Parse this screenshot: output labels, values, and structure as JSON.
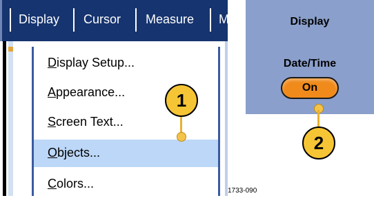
{
  "menubar": {
    "items": [
      {
        "label": "Display"
      },
      {
        "label": "Cursor"
      },
      {
        "label": "Measure"
      },
      {
        "label": "M"
      }
    ]
  },
  "dropdown": {
    "items": [
      {
        "label": "Display Setup...",
        "mnemonic": "D",
        "rest": "isplay Setup...",
        "selected": false
      },
      {
        "label": "Appearance...",
        "mnemonic": "A",
        "rest": "ppearance...",
        "selected": false
      },
      {
        "label": "Screen Text...",
        "mnemonic": "S",
        "rest": "creen Text...",
        "selected": false
      },
      {
        "label": "Objects...",
        "mnemonic": "O",
        "rest": "bjects...",
        "selected": true
      },
      {
        "label": "Colors...",
        "mnemonic": "C",
        "rest": "olors...",
        "selected": false
      }
    ]
  },
  "panel": {
    "title": "Display",
    "subtitle": "Date/Time",
    "toggle_label": "On"
  },
  "callouts": {
    "step1": "1",
    "step2": "2"
  },
  "figure_id": "1733-090",
  "colors": {
    "menubar_bg": "#16346f",
    "selected_row": "#bcd7f7",
    "panel_bg": "#8a9fcb",
    "toggle_orange": "#f08a1b",
    "callout_yellow": "#f6c535"
  },
  "icons": [
    "callout-1-icon",
    "callout-2-icon"
  ]
}
